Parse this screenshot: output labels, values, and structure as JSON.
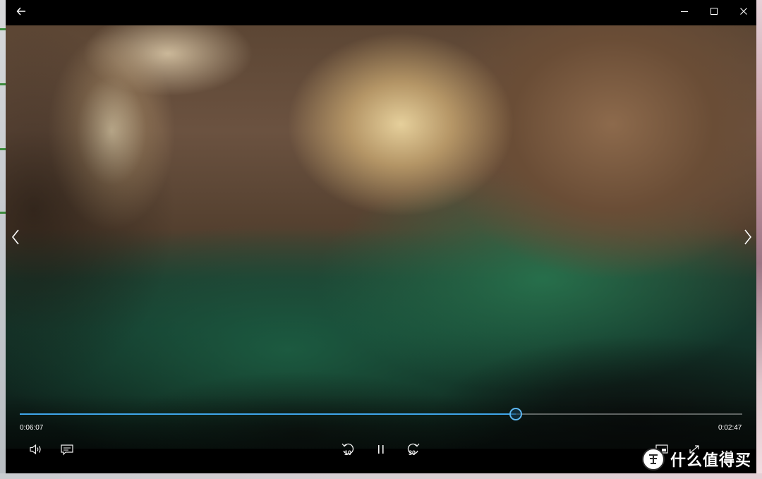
{
  "player": {
    "elapsed": "0:06:07",
    "remaining": "0:02:47",
    "progress_fraction": 0.687,
    "skip_back_seconds": "10",
    "skip_forward_seconds": "30",
    "state": "playing"
  },
  "icons": {
    "back": "back-arrow-icon",
    "minimize": "minimize-icon",
    "maximize": "maximize-icon",
    "close": "close-icon",
    "previous": "chevron-left-icon",
    "next": "chevron-right-icon",
    "volume": "volume-icon",
    "captions": "captions-icon",
    "skip_back": "skip-back-10-icon",
    "pause": "pause-icon",
    "skip_forward": "skip-forward-30-icon",
    "miniview": "mini-view-icon",
    "fullscreen": "fullscreen-icon",
    "more": "more-icon"
  },
  "colors": {
    "accent": "#3fa6ea",
    "titlebar": "#000000",
    "control_text": "#ffffff"
  },
  "watermark": {
    "text": "什么值得买",
    "seal": "值"
  }
}
